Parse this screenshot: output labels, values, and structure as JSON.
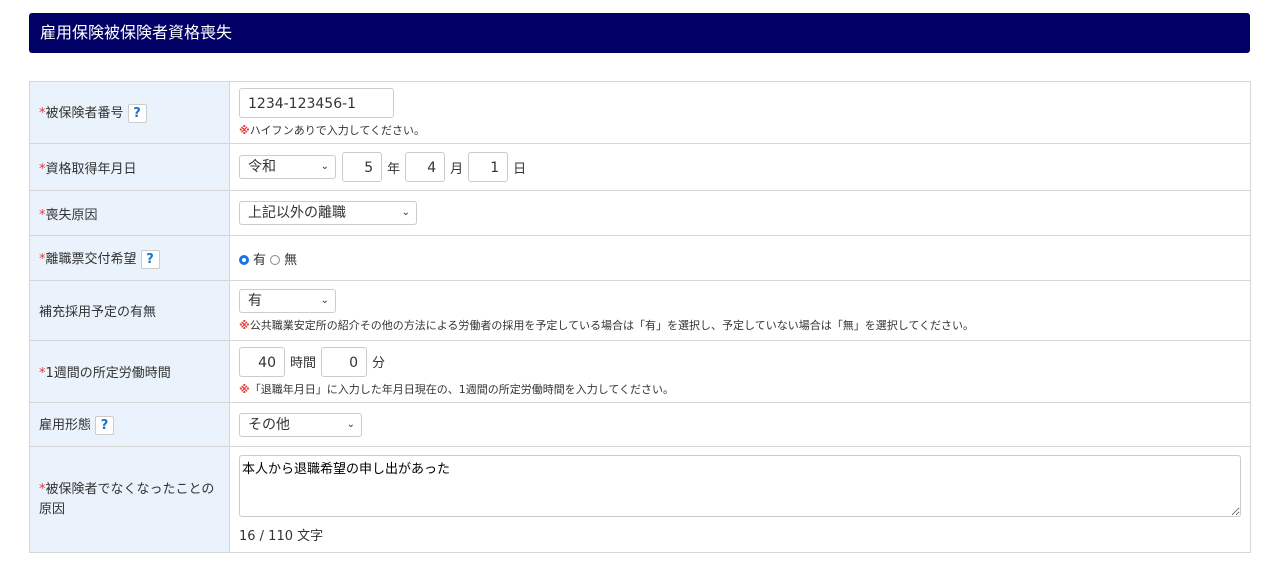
{
  "title": "雇用保険被保険者資格喪失",
  "help": "?",
  "required_mark": "*",
  "note_mark": "※",
  "rows": {
    "insured_no": {
      "label": "被保険者番号",
      "value": "1234-123456-1",
      "note": "ハイフンありで入力してください。"
    },
    "acquired_date": {
      "label": "資格取得年月日",
      "era": "令和",
      "year": "5",
      "year_unit": "年",
      "month": "4",
      "month_unit": "月",
      "day": "1",
      "day_unit": "日"
    },
    "loss_reason": {
      "label": "喪失原因",
      "value": "上記以外の離職"
    },
    "separation_slip": {
      "label": "離職票交付希望",
      "opt_yes": "有",
      "opt_no": "無"
    },
    "replacement": {
      "label": "補充採用予定の有無",
      "value": "有",
      "note": "公共職業安定所の紹介その他の方法による労働者の採用を予定している場合は「有」を選択し、予定していない場合は「無」を選択してください。"
    },
    "weekly_hours": {
      "label": "1週間の所定労働時間",
      "hours": "40",
      "hours_unit": "時間",
      "minutes": "0",
      "minutes_unit": "分",
      "note": "「退職年月日」に入力した年月日現在の、1週間の所定労働時間を入力してください。"
    },
    "employment_type": {
      "label": "雇用形態",
      "value": "その他"
    },
    "cause": {
      "label": "被保険者でなくなったことの原因",
      "value": "本人から退職希望の申し出があった",
      "counter": "16 / 110 文字"
    }
  }
}
